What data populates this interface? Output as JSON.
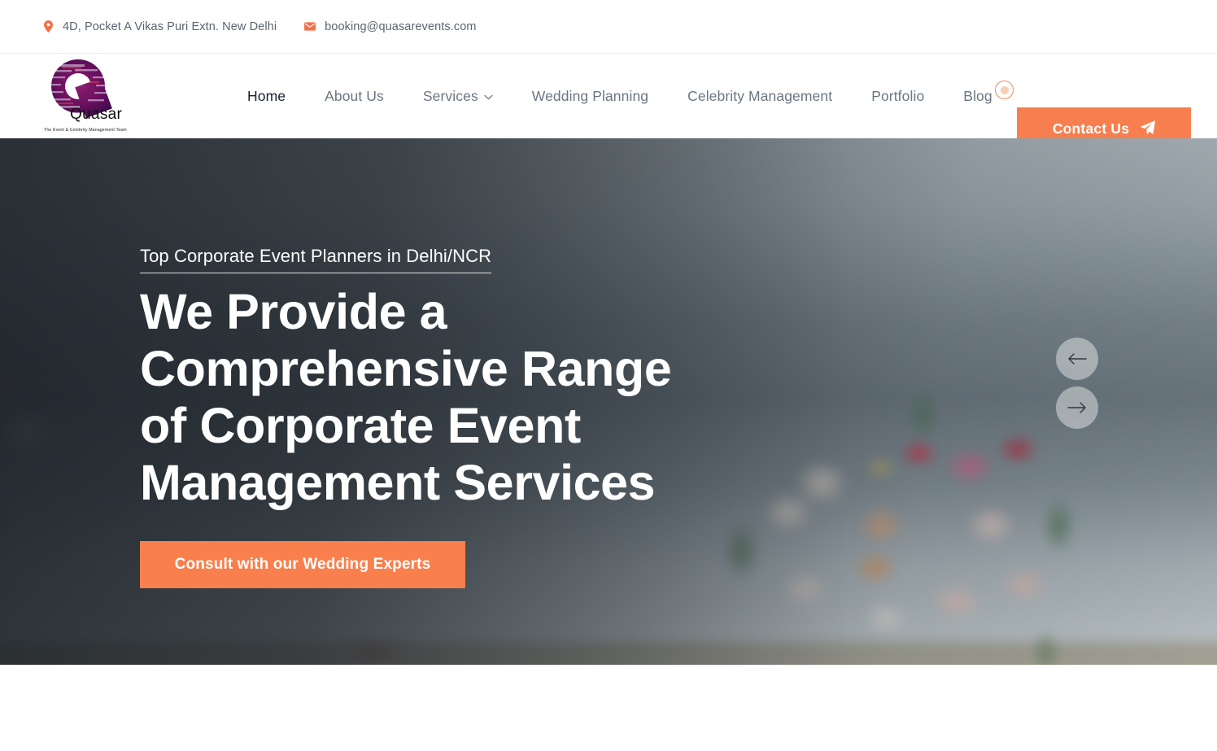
{
  "topbar": {
    "address": "4D, Pocket A Vikas Puri Extn. New Delhi",
    "address_icon": "map-pin-icon",
    "email": "booking@quasarevents.com",
    "email_icon": "envelope-icon"
  },
  "brand": {
    "name": "Quasar",
    "tagline": "The Event & Celebrity Management Team",
    "logo_icon": "quasar-q-wordcloud-logo"
  },
  "nav": {
    "items": [
      {
        "label": "Home",
        "active": true,
        "has_dropdown": false
      },
      {
        "label": "About Us",
        "active": false,
        "has_dropdown": false
      },
      {
        "label": "Services",
        "active": false,
        "has_dropdown": true
      },
      {
        "label": "Wedding Planning",
        "active": false,
        "has_dropdown": false
      },
      {
        "label": "Celebrity Management",
        "active": false,
        "has_dropdown": false
      },
      {
        "label": "Portfolio",
        "active": false,
        "has_dropdown": false
      },
      {
        "label": "Blog",
        "active": false,
        "has_dropdown": false
      }
    ],
    "contact_button": {
      "label": "Contact Us",
      "icon": "paper-plane-icon"
    }
  },
  "hero": {
    "eyebrow": "Top Corporate Event Planners in Delhi/NCR",
    "title_lines": [
      "We Provide a",
      "Comprehensive Range",
      "of Corporate Event",
      "Management Services"
    ],
    "cta_label": "Consult with our Wedding Experts",
    "slider": {
      "prev_icon": "arrow-left-icon",
      "next_icon": "arrow-right-icon"
    }
  },
  "colors": {
    "accent_orange": "#f97f4d",
    "accent_orange_soft": "#fbe9dd",
    "nav_text": "#6b7682",
    "nav_active_text": "#15202b",
    "topbar_text": "#5b6470"
  }
}
